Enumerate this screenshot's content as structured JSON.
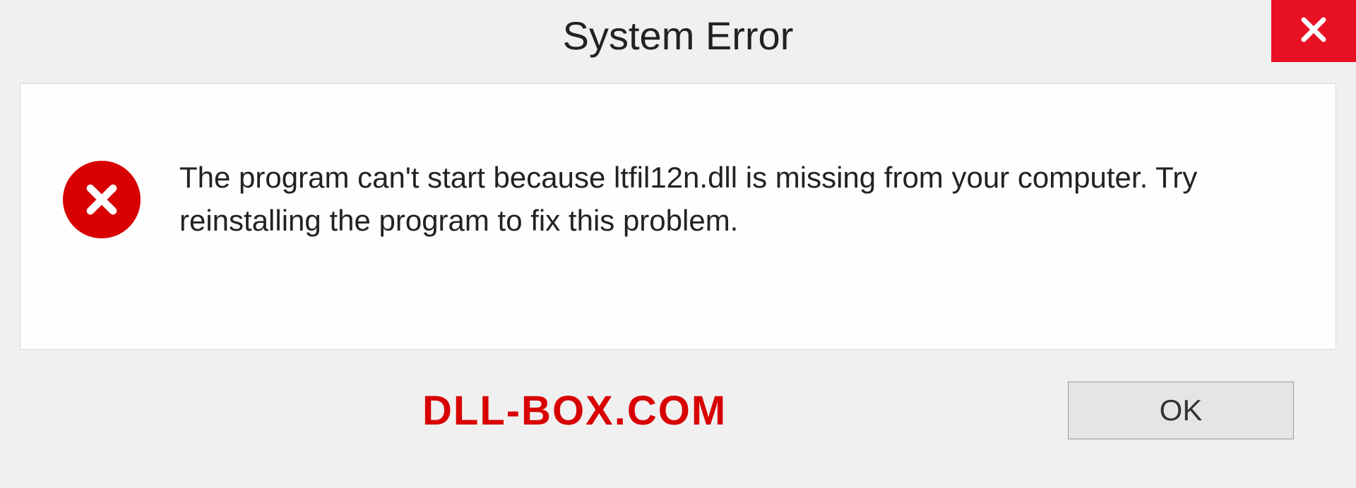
{
  "titlebar": {
    "title": "System Error"
  },
  "dialog": {
    "message": "The program can't start because ltfil12n.dll is missing from your computer. Try reinstalling the program to fix this problem."
  },
  "footer": {
    "watermark": "DLL-BOX.COM",
    "ok_label": "OK"
  },
  "colors": {
    "close_bg": "#e81123",
    "error_red": "#d80000"
  }
}
